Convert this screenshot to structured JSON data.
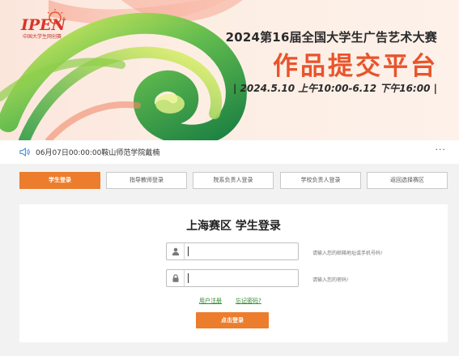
{
  "banner": {
    "logo_text": "中国大学生网创赛",
    "logo_mark": "IPEN",
    "title": "2024第16届全国大学生广告艺术大赛",
    "main_title": "作品提交平台",
    "date_range": "| 2024.5.10 上午10:00-6.12 下午16:00 |",
    "accent_color": "#e8542b"
  },
  "notice": {
    "message": "06月07日00:00:00鞍山师范学院戴楠",
    "more": "···"
  },
  "tabs": [
    {
      "label": "学生登录",
      "active": true
    },
    {
      "label": "指导教师登录",
      "active": false
    },
    {
      "label": "院系负责人登录",
      "active": false
    },
    {
      "label": "学校负责人登录",
      "active": false
    },
    {
      "label": "返回选择赛区",
      "active": false
    }
  ],
  "login": {
    "title": "上海赛区 学生登录",
    "username": {
      "value": "",
      "hint": "请输入您的邮箱地址或手机号码!"
    },
    "password": {
      "value": "",
      "hint": "请输入您的密码!"
    },
    "register_link": "用户注册",
    "forgot_link": "忘记密码?",
    "submit_label": "点击登录",
    "button_color": "#ec7d2c"
  }
}
